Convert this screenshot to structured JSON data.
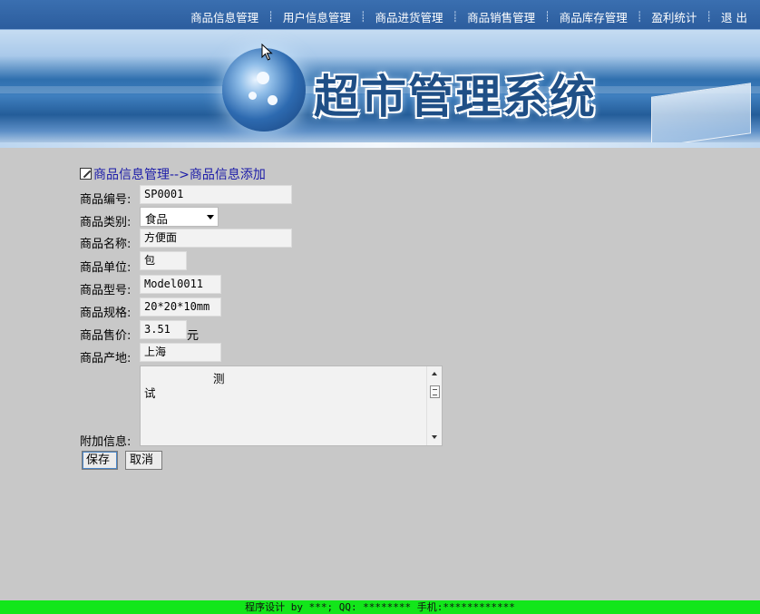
{
  "nav": {
    "items": [
      {
        "label": "商品信息管理"
      },
      {
        "label": "用户信息管理"
      },
      {
        "label": "商品进货管理"
      },
      {
        "label": "商品销售管理"
      },
      {
        "label": "商品库存管理"
      },
      {
        "label": "盈利统计"
      },
      {
        "label": "退 出"
      }
    ],
    "separator": "┊"
  },
  "banner": {
    "title": "超市管理系统"
  },
  "form": {
    "heading": "商品信息管理-->商品信息添加",
    "fields": {
      "code": {
        "label": "商品编号:",
        "value": "SP0001"
      },
      "category": {
        "label": "商品类别:",
        "value": "食品"
      },
      "name": {
        "label": "商品名称:",
        "value": "方便面"
      },
      "unit": {
        "label": "商品单位:",
        "value": "包"
      },
      "model": {
        "label": "商品型号:",
        "value": "Model0011"
      },
      "spec": {
        "label": "商品规格:",
        "value": "20*20*10mm"
      },
      "price": {
        "label": "商品售价:",
        "value": "3.51",
        "unit": "元"
      },
      "origin": {
        "label": "商品产地:",
        "value": "上海"
      },
      "extra": {
        "label": "附加信息:",
        "line1": "测",
        "line2": "试"
      }
    },
    "buttons": {
      "save": "保存",
      "cancel": "取消"
    }
  },
  "footer": {
    "text": "程序设计 by ***; QQ: ******** 手机:************"
  },
  "colors": {
    "nav_bg": "#3a6fb0",
    "page_bg": "#c8c8c8",
    "heading": "#1a1aa8",
    "footer_bg": "#12e61a"
  }
}
